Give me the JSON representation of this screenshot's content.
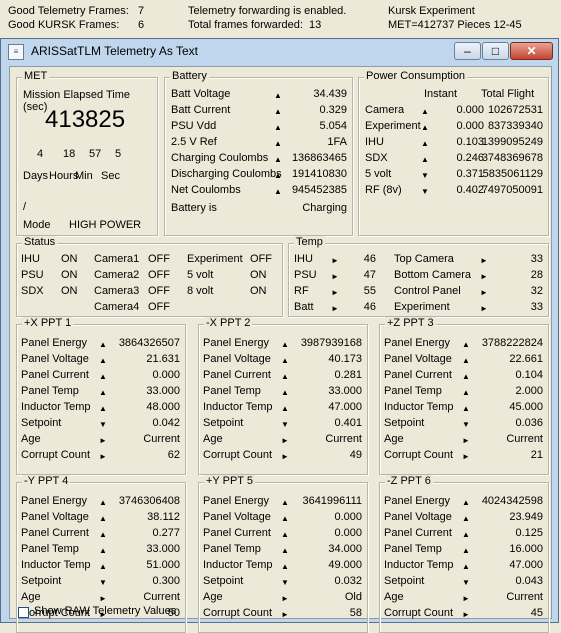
{
  "status_strip": {
    "good_telemetry_label": "Good Telemetry Frames:",
    "good_telemetry_value": "7",
    "good_kursk_label": "Good KURSK Frames:",
    "good_kursk_value": "6",
    "forwarding_msg": "Telemetry forwarding is enabled.",
    "total_forwarded_label": "Total frames forwarded:",
    "total_forwarded_value": "13",
    "experiment": "Kursk Experiment",
    "met_pieces": "MET=412737 Pieces 12-45"
  },
  "window": {
    "title": "ARISSatTLM Telemetry As Text",
    "minimize": "–",
    "maximize": "□",
    "close": "✕"
  },
  "met": {
    "legend": "MET",
    "subtitle": "Mission Elapsed Time (sec)",
    "value": "413825",
    "parts": [
      "4",
      "18",
      "57",
      "5"
    ],
    "part_labels": [
      "Days",
      "Hours",
      "Min",
      "Sec"
    ],
    "slash": "/",
    "mode_label": "Mode",
    "mode_value": "HIGH POWER"
  },
  "battery": {
    "legend": "Battery",
    "rows": [
      {
        "label": "Batt Voltage",
        "value": "34.439"
      },
      {
        "label": "Batt Current",
        "value": "0.329"
      },
      {
        "label": "PSU Vdd",
        "value": "5.054"
      },
      {
        "label": "2.5 V Ref",
        "value": "1FA"
      },
      {
        "label": "Charging Coulombs",
        "value": "136863465"
      },
      {
        "label": "Discharging Coulombs",
        "value": "191410830"
      },
      {
        "label": "Net Coulombs",
        "value": "945452385"
      }
    ],
    "state_label": "Battery is",
    "state_value": "Charging"
  },
  "power": {
    "legend": "Power Consumption",
    "col_instant": "Instant",
    "col_total": "Total Flight",
    "rows": [
      {
        "label": "Camera",
        "instant": "0.000",
        "total": "102672531"
      },
      {
        "label": "Experiment",
        "instant": "0.000",
        "total": "837339340"
      },
      {
        "label": "IHU",
        "instant": "0.103",
        "total": "1399095249"
      },
      {
        "label": "SDX",
        "instant": "0.246",
        "total": "3748369678"
      },
      {
        "label": "5 volt",
        "instant": "0.371",
        "total": "5835061129"
      },
      {
        "label": "RF (8v)",
        "instant": "0.402",
        "total": "7497050091"
      }
    ]
  },
  "status": {
    "legend": "Status",
    "col1": [
      {
        "label": "IHU",
        "value": "ON"
      },
      {
        "label": "PSU",
        "value": "ON"
      },
      {
        "label": "SDX",
        "value": "ON"
      }
    ],
    "col2": [
      {
        "label": "Camera1",
        "value": "OFF"
      },
      {
        "label": "Camera2",
        "value": "OFF"
      },
      {
        "label": "Camera3",
        "value": "OFF"
      },
      {
        "label": "Camera4",
        "value": "OFF"
      }
    ],
    "col3": [
      {
        "label": "Experiment",
        "value": "OFF"
      },
      {
        "label": "5 volt",
        "value": "ON"
      },
      {
        "label": "8 volt",
        "value": "ON"
      }
    ]
  },
  "temp": {
    "legend": "Temp",
    "left": [
      {
        "label": "IHU",
        "value": "46"
      },
      {
        "label": "PSU",
        "value": "47"
      },
      {
        "label": "RF",
        "value": "55"
      },
      {
        "label": "Batt",
        "value": "46"
      }
    ],
    "right": [
      {
        "label": "Top Camera",
        "value": "33"
      },
      {
        "label": "Bottom Camera",
        "value": "28"
      },
      {
        "label": "Control Panel",
        "value": "32"
      },
      {
        "label": "Experiment",
        "value": "33"
      }
    ]
  },
  "ppt_labels": [
    "Panel Energy",
    "Panel Voltage",
    "Panel Current",
    "Panel Temp",
    "Inductor Temp",
    "Setpoint",
    "Age",
    "Corrupt Count"
  ],
  "ppts": [
    {
      "title": "+X PPT 1",
      "values": [
        "3864326507",
        "21.631",
        "0.000",
        "33.000",
        "48.000",
        "0.042",
        "Current",
        "62"
      ]
    },
    {
      "title": "-X PPT 2",
      "values": [
        "3987939168",
        "40.173",
        "0.281",
        "33.000",
        "47.000",
        "0.401",
        "Current",
        "49"
      ]
    },
    {
      "title": "+Z PPT 3",
      "values": [
        "3788222824",
        "22.661",
        "0.104",
        "2.000",
        "45.000",
        "0.036",
        "Current",
        "21"
      ]
    },
    {
      "title": "-Y PPT 4",
      "values": [
        "3746306408",
        "38.112",
        "0.277",
        "33.000",
        "51.000",
        "0.300",
        "Current",
        "50"
      ]
    },
    {
      "title": "+Y PPT 5",
      "values": [
        "3641996111",
        "0.000",
        "0.000",
        "34.000",
        "49.000",
        "0.032",
        "Old",
        "58"
      ]
    },
    {
      "title": "-Z PPT 6",
      "values": [
        "4024342598",
        "23.949",
        "0.125",
        "16.000",
        "47.000",
        "0.043",
        "Current",
        "45"
      ]
    }
  ],
  "raw_checkbox": {
    "label": "Show RAW Telemetry Values",
    "checked": false
  },
  "colors": {
    "window_frame": "#bfd6ec",
    "client_bg": "#ece9d8",
    "group_border": "#b8b4a6"
  }
}
